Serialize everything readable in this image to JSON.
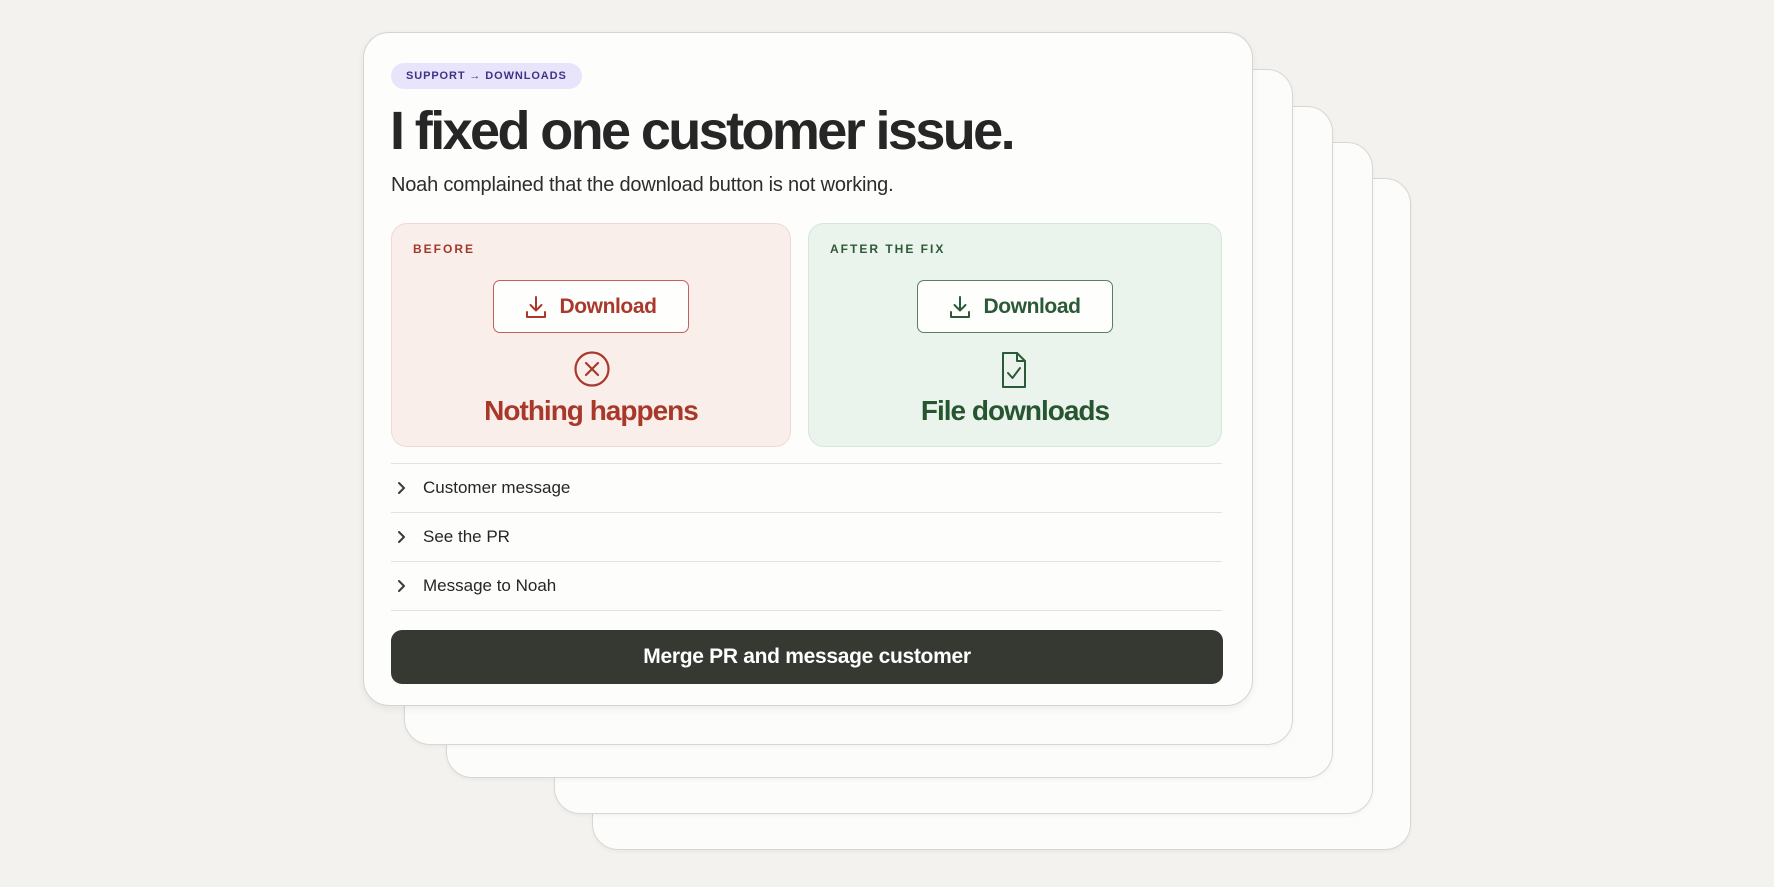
{
  "badge": "SUPPORT → DOWNLOADS",
  "title": "I fixed one customer issue.",
  "subtitle": "Noah complained that the download button is not working.",
  "before": {
    "label": "BEFORE",
    "button_label": "Download",
    "button_icon": "download-icon",
    "status_icon": "x-circle-icon",
    "status_text": "Nothing happens",
    "accent_color": "#a9392c",
    "background": "#faeeeb"
  },
  "after": {
    "label": "AFTER THE FIX",
    "button_label": "Download",
    "button_icon": "download-icon",
    "status_icon": "file-check-icon",
    "status_text": "File downloads",
    "accent_color": "#2b5a36",
    "background": "#eaf3ec"
  },
  "accordion": {
    "chevron_icon": "chevron-right-icon",
    "items": [
      {
        "label": "Customer message"
      },
      {
        "label": "See the PR"
      },
      {
        "label": "Message to Noah"
      }
    ]
  },
  "primary_action": {
    "label": "Merge PR and message customer",
    "color": "#363832"
  }
}
